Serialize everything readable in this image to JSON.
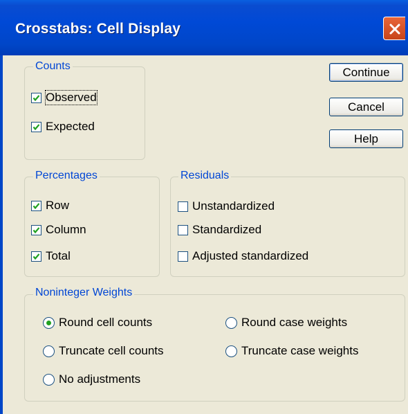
{
  "window": {
    "title": "Crosstabs: Cell Display"
  },
  "buttons": {
    "continue": "Continue",
    "cancel": "Cancel",
    "help": "Help"
  },
  "counts": {
    "legend": "Counts",
    "observed": {
      "label": "Observed",
      "checked": true
    },
    "expected": {
      "label": "Expected",
      "checked": true
    }
  },
  "percentages": {
    "legend": "Percentages",
    "row": {
      "label": "Row",
      "checked": true
    },
    "column": {
      "label": "Column",
      "checked": true
    },
    "total": {
      "label": "Total",
      "checked": true
    }
  },
  "residuals": {
    "legend": "Residuals",
    "unstandardized": {
      "label": "Unstandardized",
      "checked": false
    },
    "standardized": {
      "label": "Standardized",
      "checked": false
    },
    "adjusted": {
      "label": "Adjusted standardized",
      "checked": false
    }
  },
  "weights": {
    "legend": "Noninteger Weights",
    "round_cell": {
      "label": "Round cell counts",
      "selected": true
    },
    "round_case": {
      "label": "Round case weights",
      "selected": false
    },
    "truncate_cell": {
      "label": "Truncate cell counts",
      "selected": false
    },
    "truncate_case": {
      "label": "Truncate case weights",
      "selected": false
    },
    "no_adjust": {
      "label": "No adjustments",
      "selected": false
    }
  },
  "colors": {
    "accent": "#0046D5",
    "check": "#21A121",
    "face": "#ECE9D8",
    "titlebar": "#0046C8"
  }
}
